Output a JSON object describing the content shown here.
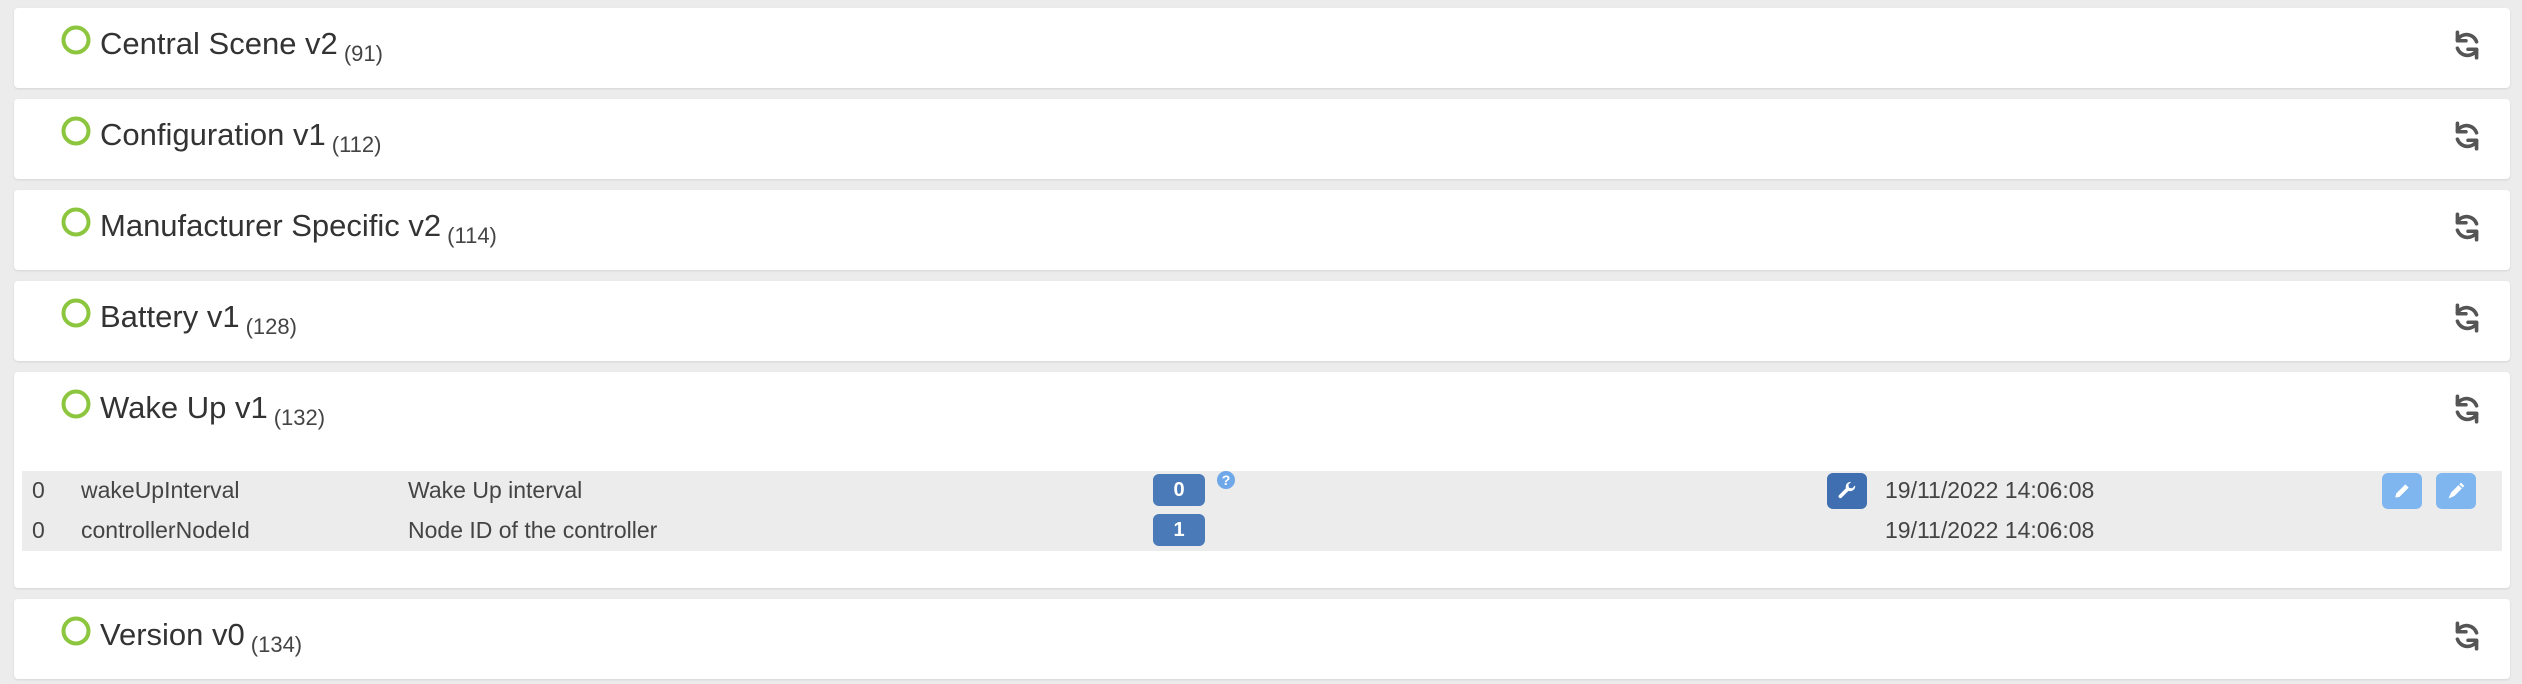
{
  "colors": {
    "status_ring": "#8cc63f",
    "badge": "#4a7ab8",
    "light_button": "#7fb6ef",
    "dark_button": "#3f6fb0",
    "page_background": "#ececec"
  },
  "panels": [
    {
      "name": "Central Scene v2",
      "id": "(91)",
      "status_icon": "ring-icon",
      "action_icon": "refresh-icon"
    },
    {
      "name": "Configuration v1",
      "id": "(112)",
      "status_icon": "ring-icon",
      "action_icon": "refresh-icon"
    },
    {
      "name": "Manufacturer Specific v2",
      "id": "(114)",
      "status_icon": "ring-icon",
      "action_icon": "refresh-icon"
    },
    {
      "name": "Battery v1",
      "id": "(128)",
      "status_icon": "ring-icon",
      "action_icon": "refresh-icon"
    },
    {
      "name": "Wake Up v1",
      "id": "(132)",
      "status_icon": "ring-icon",
      "action_icon": "refresh-icon"
    },
    {
      "name": "Version v0",
      "id": "(134)",
      "status_icon": "ring-icon",
      "action_icon": "refresh-icon"
    }
  ],
  "wakeup_values": [
    {
      "instance": "0",
      "key": "wakeUpInterval",
      "label": "Wake Up interval",
      "value": "0",
      "help": "?",
      "updated": "19/11/2022 14:06:08"
    },
    {
      "instance": "0",
      "key": "controllerNodeId",
      "label": "Node ID of the controller",
      "value": "1",
      "updated": "19/11/2022 14:06:08"
    }
  ]
}
